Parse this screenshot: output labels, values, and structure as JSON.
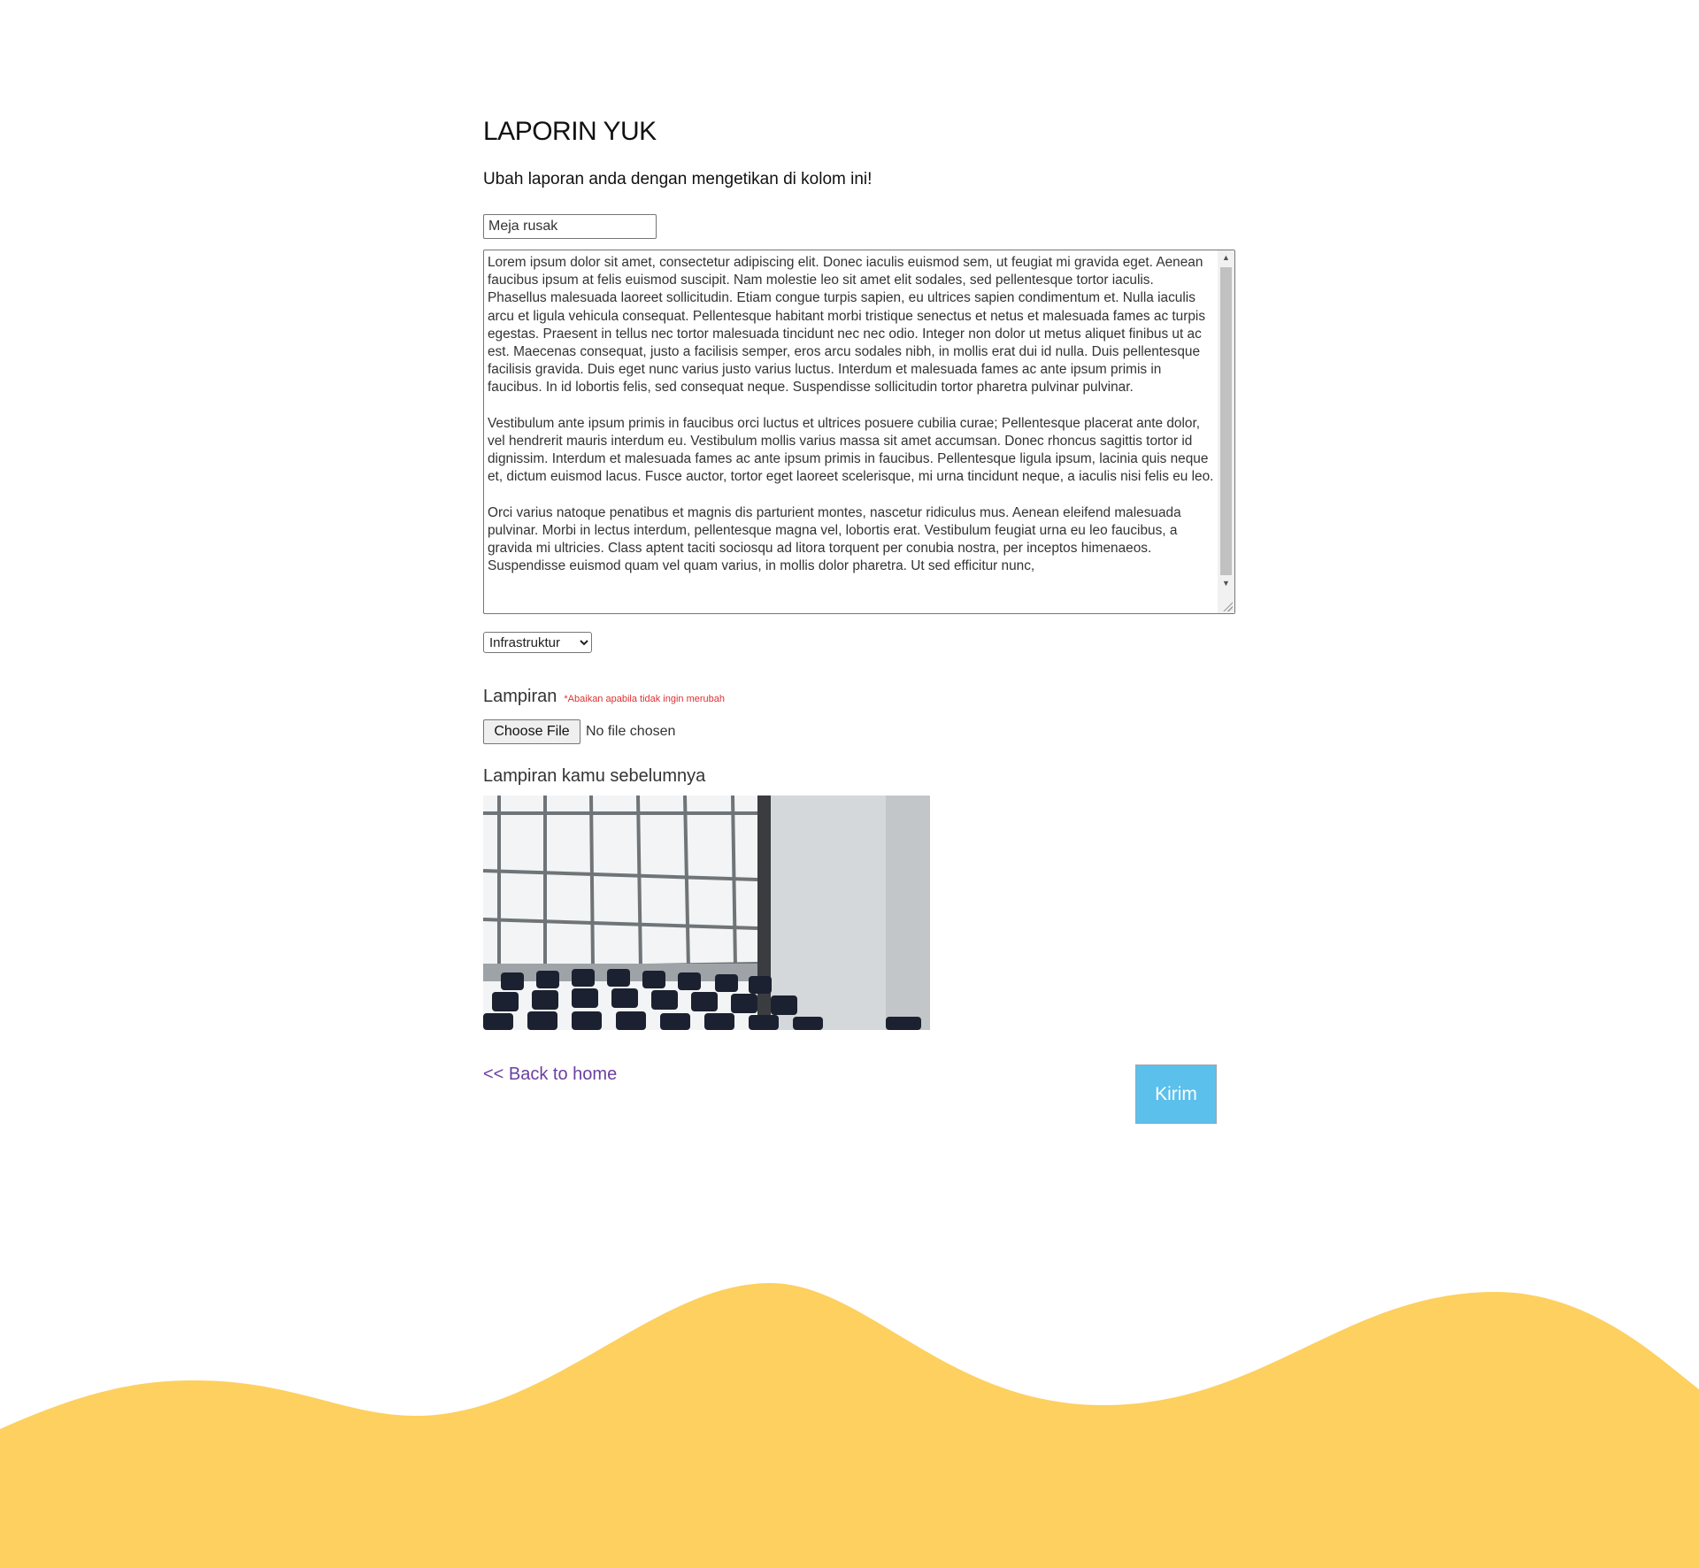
{
  "page": {
    "title": "LAPORIN YUK",
    "subtitle": "Ubah laporan anda dengan mengetikan di kolom ini!"
  },
  "form": {
    "title_value": "Meja rusak",
    "description_value": "Lorem ipsum dolor sit amet, consectetur adipiscing elit. Donec iaculis euismod sem, ut feugiat mi gravida eget. Aenean faucibus ipsum at felis euismod suscipit. Nam molestie leo sit amet elit sodales, sed pellentesque tortor iaculis. Phasellus malesuada laoreet sollicitudin. Etiam congue turpis sapien, eu ultrices sapien condimentum et. Nulla iaculis arcu et ligula vehicula consequat. Pellentesque habitant morbi tristique senectus et netus et malesuada fames ac turpis egestas. Praesent in tellus nec tortor malesuada tincidunt nec nec odio. Integer non dolor ut metus aliquet finibus ut ac est. Maecenas consequat, justo a facilisis semper, eros arcu sodales nibh, in mollis erat dui id nulla. Duis pellentesque facilisis gravida. Duis eget nunc varius justo varius luctus. Interdum et malesuada fames ac ante ipsum primis in faucibus. In id lobortis felis, sed consequat neque. Suspendisse sollicitudin tortor pharetra pulvinar pulvinar.\n\nVestibulum ante ipsum primis in faucibus orci luctus et ultrices posuere cubilia curae; Pellentesque placerat ante dolor, vel hendrerit mauris interdum eu. Vestibulum mollis varius massa sit amet accumsan. Donec rhoncus sagittis tortor id dignissim. Interdum et malesuada fames ac ante ipsum primis in faucibus. Pellentesque ligula ipsum, lacinia quis neque et, dictum euismod lacus. Fusce auctor, tortor eget laoreet scelerisque, mi urna tincidunt neque, a iaculis nisi felis eu leo.\n\nOrci varius natoque penatibus et magnis dis parturient montes, nascetur ridiculus mus. Aenean eleifend malesuada pulvinar. Morbi in lectus interdum, pellentesque magna vel, lobortis erat. Vestibulum feugiat urna eu leo faucibus, a gravida mi ultricies. Class aptent taciti sociosqu ad litora torquent per conubia nostra, per inceptos himenaeos. Suspendisse euismod quam vel quam varius, in mollis dolor pharetra. Ut sed efficitur nunc,",
    "category_selected": "Infrastruktur",
    "attachment_label": "Lampiran",
    "attachment_note": "*Abaikan apabila tidak ingin merubah",
    "choose_file_label": "Choose File",
    "file_status": "No file chosen",
    "previous_attachment_label": "Lampiran kamu sebelumnya",
    "back_link": "<< Back to home",
    "submit_label": "Kirim"
  },
  "icons": {
    "select_arrow": "chevron-down-icon",
    "scroll_up": "scroll-up-arrow-icon",
    "scroll_down": "scroll-down-arrow-icon"
  },
  "colors": {
    "submit_bg": "#5bc0eb",
    "link": "#6b3fa0",
    "note": "#e03030",
    "wave": "#fdd05f"
  }
}
